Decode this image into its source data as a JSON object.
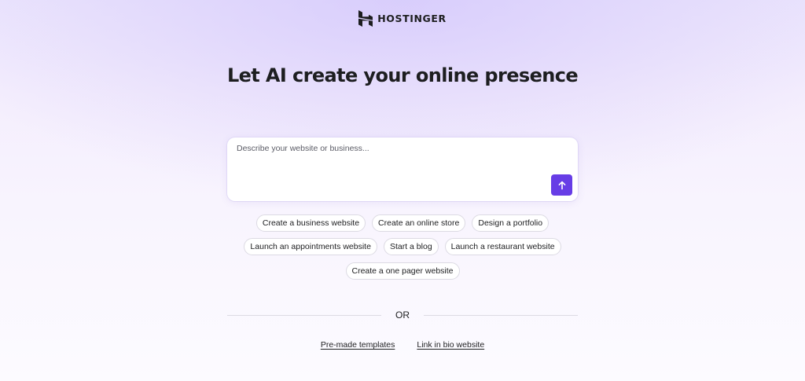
{
  "brand": {
    "name": "HOSTINGER",
    "logo_icon": "hostinger-logo-icon",
    "accent_color": "#673de6"
  },
  "headline": "Let AI create your online presence",
  "prompt": {
    "placeholder": "Describe your website or business...",
    "value": "",
    "send_icon": "arrow-up-icon"
  },
  "suggestions": {
    "row1": [
      "Create a business website",
      "Create an online store",
      "Design a portfolio"
    ],
    "row2": [
      "Launch an appointments website",
      "Start a blog",
      "Launch a restaurant website"
    ],
    "row3": [
      "Create a one pager website"
    ]
  },
  "divider_text": "OR",
  "links": {
    "templates": "Pre-made templates",
    "link_in_bio": "Link in bio website"
  }
}
